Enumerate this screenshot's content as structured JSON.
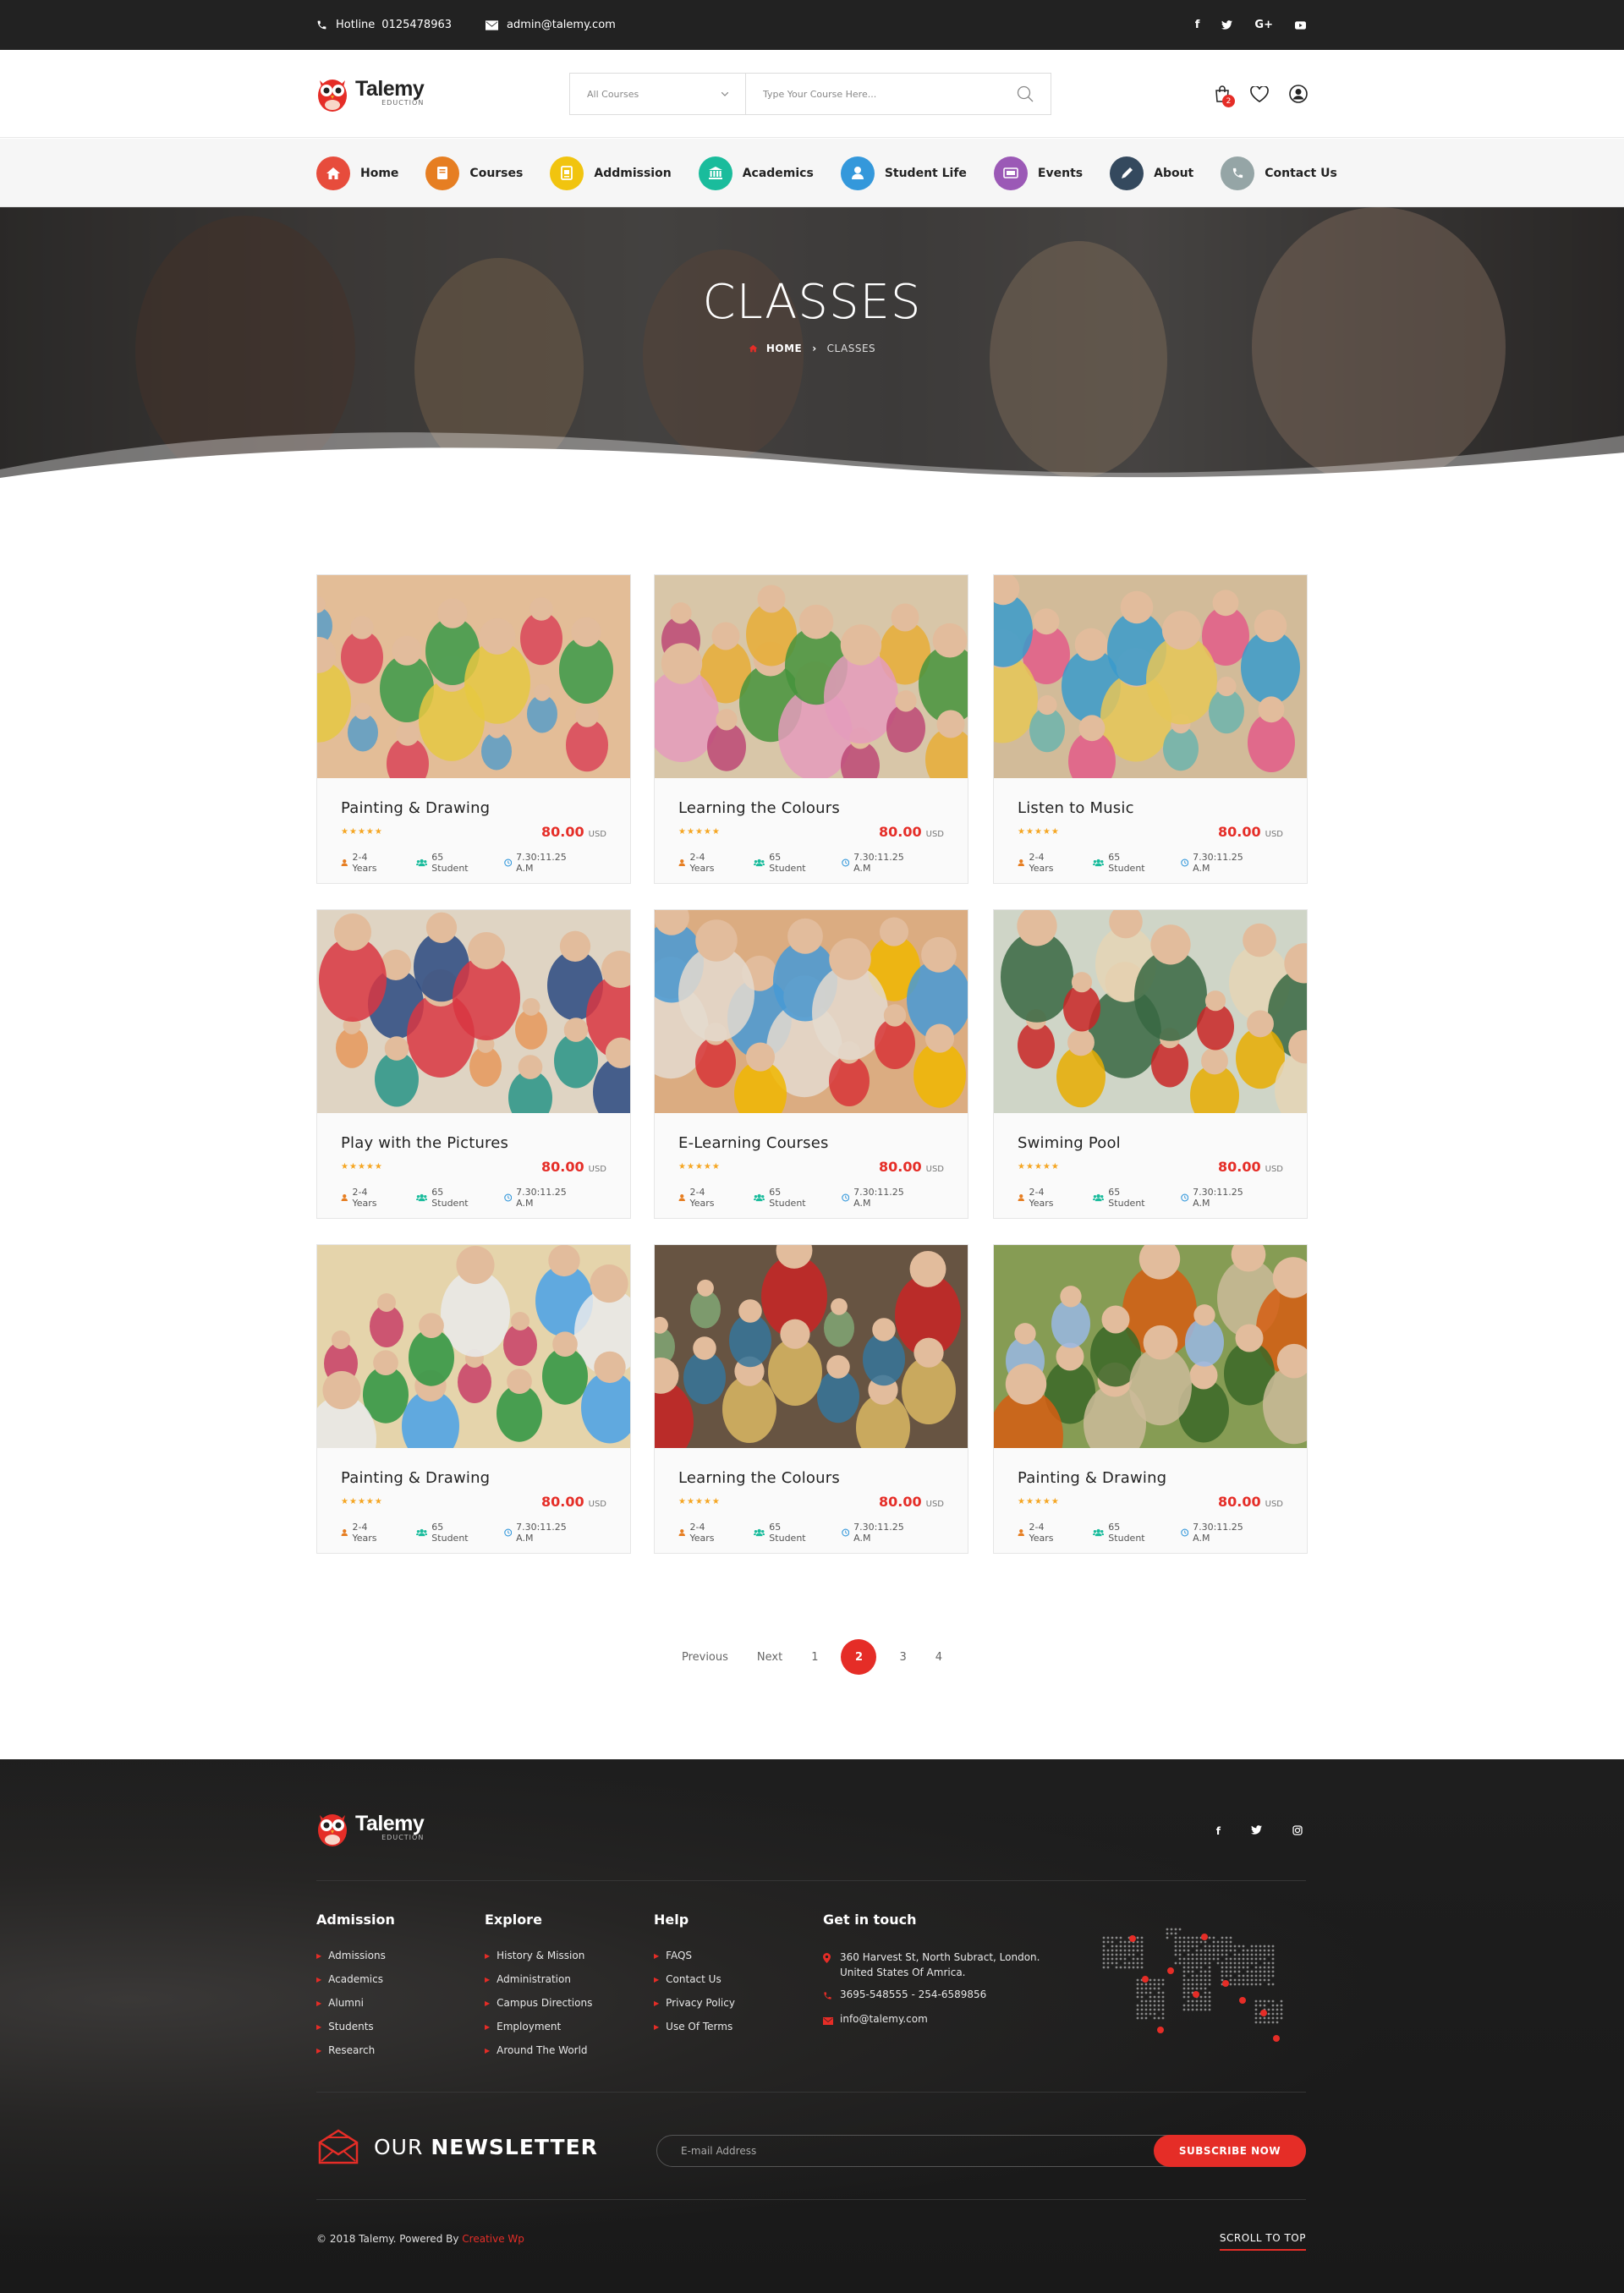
{
  "topbar": {
    "hotline_label": "Hotline",
    "hotline_number": "0125478963",
    "email": "admin@talemy.com",
    "social": [
      "f",
      "t",
      "G+",
      "yt"
    ]
  },
  "header": {
    "brand": "Talemy",
    "brand_sub": "EDUCTION",
    "category_select": "All Courses",
    "search_placeholder": "Type Your Course Here...",
    "cart_count": "2"
  },
  "nav": {
    "items": [
      {
        "label": "Home",
        "color": "#e74c3c",
        "icon": "home-icon"
      },
      {
        "label": "Courses",
        "color": "#e67e22",
        "icon": "book-icon"
      },
      {
        "label": "Addmission",
        "color": "#f1c40f",
        "icon": "document-icon"
      },
      {
        "label": "Academics",
        "color": "#1abc9c",
        "icon": "bank-icon"
      },
      {
        "label": "Student Life",
        "color": "#3498db",
        "icon": "user-icon"
      },
      {
        "label": "Events",
        "color": "#9b59b6",
        "icon": "ticket-icon"
      },
      {
        "label": "About",
        "color": "#34495e",
        "icon": "pen-icon"
      },
      {
        "label": "Contact Us",
        "color": "#95a5a6",
        "icon": "phone-icon"
      }
    ]
  },
  "banner": {
    "title": "CLASSES",
    "crumb_home": "HOME",
    "crumb_current": "CLASSES"
  },
  "courses": [
    {
      "title": "Painting & Drawing",
      "price": "80.00",
      "currency": "USD",
      "age": "2-4 Years",
      "students": "65  Student",
      "time": "7.30:11.25 A.M",
      "rating": 5
    },
    {
      "title": "Learning the Colours",
      "price": "80.00",
      "currency": "USD",
      "age": "2-4 Years",
      "students": "65  Student",
      "time": "7.30:11.25 A.M",
      "rating": 5
    },
    {
      "title": "Listen to Music",
      "price": "80.00",
      "currency": "USD",
      "age": "2-4 Years",
      "students": "65  Student",
      "time": "7.30:11.25 A.M",
      "rating": 5
    },
    {
      "title": "Play with the Pictures",
      "price": "80.00",
      "currency": "USD",
      "age": "2-4 Years",
      "students": "65  Student",
      "time": "7.30:11.25 A.M",
      "rating": 5
    },
    {
      "title": "E-Learning Courses",
      "price": "80.00",
      "currency": "USD",
      "age": "2-4 Years",
      "students": "65  Student",
      "time": "7.30:11.25 A.M",
      "rating": 5
    },
    {
      "title": "Swiming Pool",
      "price": "80.00",
      "currency": "USD",
      "age": "2-4 Years",
      "students": "65  Student",
      "time": "7.30:11.25 A.M",
      "rating": 5
    },
    {
      "title": "Painting & Drawing",
      "price": "80.00",
      "currency": "USD",
      "age": "2-4 Years",
      "students": "65  Student",
      "time": "7.30:11.25 A.M",
      "rating": 5
    },
    {
      "title": "Learning the Colours",
      "price": "80.00",
      "currency": "USD",
      "age": "2-4 Years",
      "students": "65  Student",
      "time": "7.30:11.25 A.M",
      "rating": 5
    },
    {
      "title": "Painting & Drawing",
      "price": "80.00",
      "currency": "USD",
      "age": "2-4 Years",
      "students": "65  Student",
      "time": "7.30:11.25 A.M",
      "rating": 5
    }
  ],
  "pagination": {
    "previous": "Previous",
    "next": "Next",
    "pages": [
      "1",
      "2",
      "3",
      "4"
    ],
    "active": "2"
  },
  "footer": {
    "brand": "Talemy",
    "brand_sub": "EDUCTION",
    "columns": [
      {
        "title": "Admission",
        "links": [
          "Admissions",
          "Academics",
          "Alumni",
          "Students",
          "Research"
        ]
      },
      {
        "title": "Explore",
        "links": [
          "History & Mission",
          "Administration",
          "Campus Directions",
          "Employment",
          "Around The World"
        ]
      },
      {
        "title": "Help",
        "links": [
          "FAQS",
          "Contact Us",
          "Privacy Policy",
          "Use Of Terms"
        ]
      }
    ],
    "contact": {
      "title": "Get in touch",
      "address_line1": "360 Harvest St, North Subract, London.",
      "address_line2": "United States Of Amrica.",
      "phone": "3695-548555   -   254-6589856",
      "email": "info@talemy.com"
    },
    "newsletter": {
      "label_prefix": "OUR",
      "label_bold": "NEWSLETTER",
      "placeholder": "E-mail Address",
      "button": "SUBSCRIBE NOW"
    },
    "copyright": "© 2018 Talemy.  Powered By",
    "powered": "Creative Wp",
    "scroll_top": "SCROLL TO TOP"
  },
  "colors": {
    "accent": "#e52d27",
    "topbar": "#222222",
    "footer": "#1d1d1d"
  }
}
